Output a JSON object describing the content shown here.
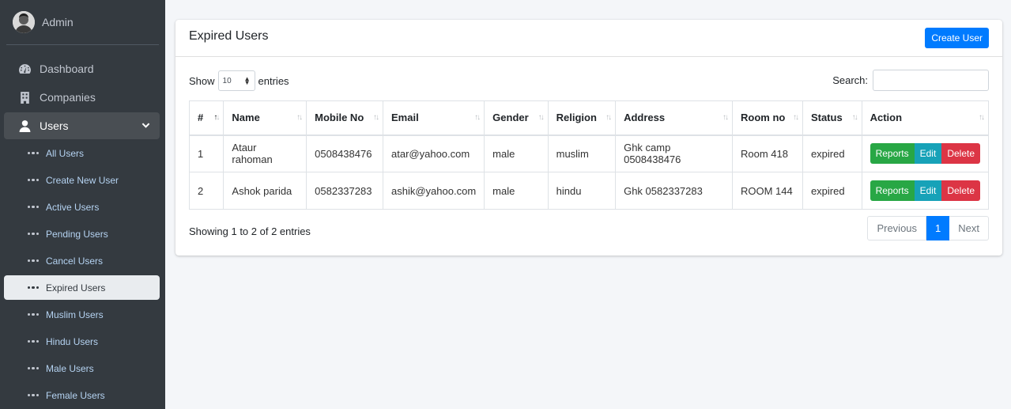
{
  "sidebar": {
    "user": "Admin",
    "items": [
      {
        "label": "Dashboard",
        "icon": "dashboard-icon"
      },
      {
        "label": "Companies",
        "icon": "building-icon"
      },
      {
        "label": "Users",
        "icon": "user-icon"
      }
    ],
    "sub_items": [
      {
        "label": "All Users"
      },
      {
        "label": "Create New User"
      },
      {
        "label": "Active Users"
      },
      {
        "label": "Pending Users"
      },
      {
        "label": "Cancel Users"
      },
      {
        "label": "Expired Users",
        "active": true
      },
      {
        "label": "Muslim Users"
      },
      {
        "label": "Hindu Users"
      },
      {
        "label": "Male Users"
      },
      {
        "label": "Female Users"
      }
    ]
  },
  "card": {
    "title": "Expired Users",
    "create_button": "Create User"
  },
  "controls": {
    "show_label": "Show",
    "entries_value": "10",
    "entries_label": "entries",
    "search_label": "Search:"
  },
  "table": {
    "columns": [
      "#",
      "Name",
      "Mobile No",
      "Email",
      "Gender",
      "Religion",
      "Address",
      "Room no",
      "Status",
      "Action"
    ],
    "rows": [
      {
        "num": "1",
        "name": "Ataur rahoman",
        "mobile": "0508438476",
        "email": "atar@yahoo.com",
        "gender": "male",
        "religion": "muslim",
        "address": "Ghk camp 0508438476",
        "room": "Room 418",
        "status": "expired"
      },
      {
        "num": "2",
        "name": "Ashok parida",
        "mobile": "0582337283",
        "email": "ashik@yahoo.com",
        "gender": "male",
        "religion": "hindu",
        "address": "Ghk 0582337283",
        "room": "ROOM 144",
        "status": "expired"
      }
    ],
    "action_labels": {
      "reports": "Reports",
      "edit": "Edit",
      "delete": "Delete"
    }
  },
  "footer": {
    "info": "Showing 1 to 2 of 2 entries",
    "prev": "Previous",
    "page": "1",
    "next": "Next"
  },
  "colors": {
    "primary": "#007bff",
    "success": "#28a745",
    "info": "#17a2b8",
    "danger": "#dc3545",
    "sidebar": "#343a40"
  }
}
